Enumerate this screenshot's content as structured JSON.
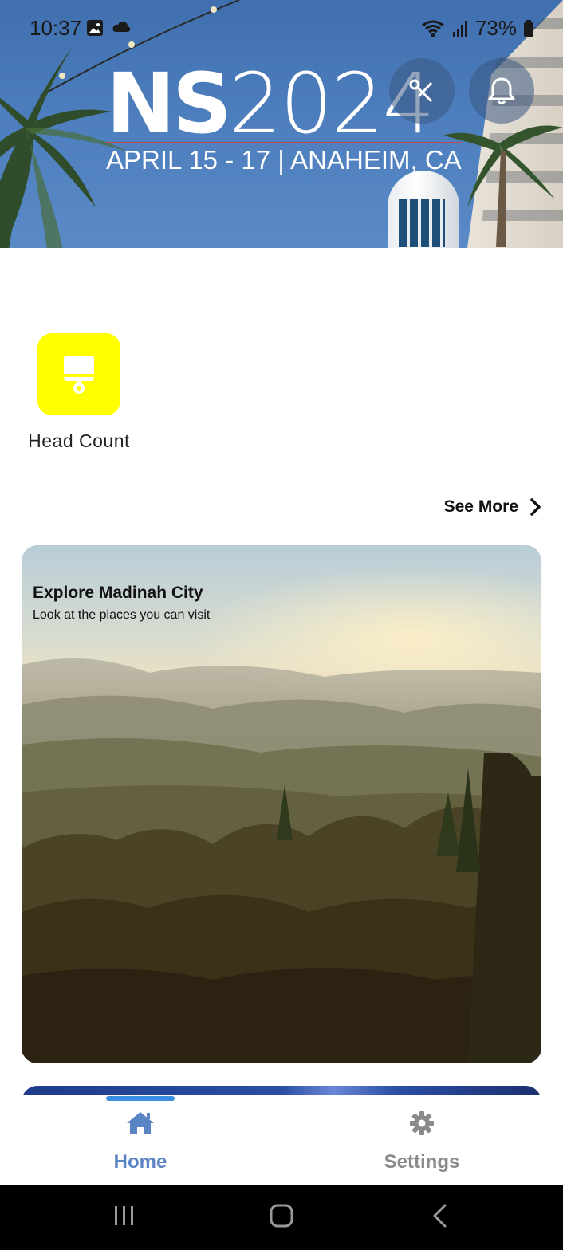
{
  "status_bar": {
    "time": "10:37",
    "battery": "73%"
  },
  "hero": {
    "logo_ns": "NS",
    "logo_year": "2024",
    "logo_subtitle": "APRIL 15 - 17 | ANAHEIM, CA",
    "share_icon": "share-icon",
    "bell_icon": "bell-icon"
  },
  "quick_actions": [
    {
      "label": "Head Count",
      "icon": "head-count-icon",
      "color": "#ffff00"
    }
  ],
  "see_more": {
    "label": "See More"
  },
  "feature_card": {
    "title": "Explore Madinah City",
    "subtitle": "Look at the places you can visit"
  },
  "bottom_nav": {
    "items": [
      {
        "label": "Home",
        "icon": "home-icon",
        "active": true,
        "color": "#5b84c4"
      },
      {
        "label": "Settings",
        "icon": "gear-icon",
        "active": false,
        "color": "#8a8a8a"
      }
    ]
  },
  "colors": {
    "accent": "#5b84c4",
    "indicator": "#3a8fe0",
    "quick_action_bg": "#ffff00"
  }
}
